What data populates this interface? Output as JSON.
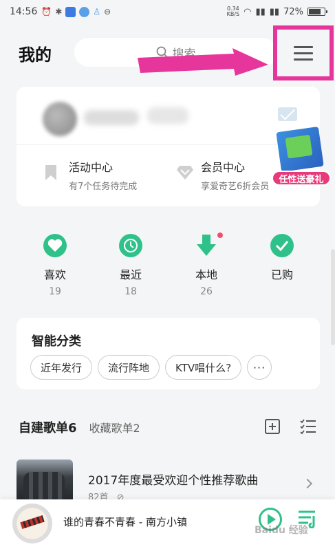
{
  "status_bar": {
    "time": "14:56",
    "speed_value": "0.34",
    "speed_unit": "KB/S",
    "battery": "72%",
    "battery_level": 0.72
  },
  "header": {
    "title": "我的",
    "search_placeholder": "搜索"
  },
  "profile": {
    "activity": {
      "title": "活动中心",
      "subtitle": "有7个任务待完成"
    },
    "member": {
      "title": "会员中心",
      "subtitle": "享爱奇艺6折会员"
    },
    "gift_label": "任性送豪礼"
  },
  "quick_access": [
    {
      "label": "喜欢",
      "count": "19",
      "icon": "heart-icon"
    },
    {
      "label": "最近",
      "count": "18",
      "icon": "clock-icon"
    },
    {
      "label": "本地",
      "count": "26",
      "icon": "download-icon"
    },
    {
      "label": "已购",
      "count": "",
      "icon": "check-icon"
    }
  ],
  "smart_category": {
    "title": "智能分类",
    "chips": [
      "近年发行",
      "流行阵地",
      "KTV唱什么?",
      "···"
    ]
  },
  "playlists": {
    "tab_created": "自建歌单6",
    "tab_collected": "收藏歌单2",
    "items": [
      {
        "name": "2017年度最受欢迎个性推荐歌曲",
        "meta": "82首"
      }
    ]
  },
  "player": {
    "song": "谁的青春不青春 - 南方小镇",
    "watermark": "Baidu 经验"
  },
  "colors": {
    "accent": "#2ec28a",
    "highlight": "#e6369b",
    "gift": "#e83a7a"
  }
}
